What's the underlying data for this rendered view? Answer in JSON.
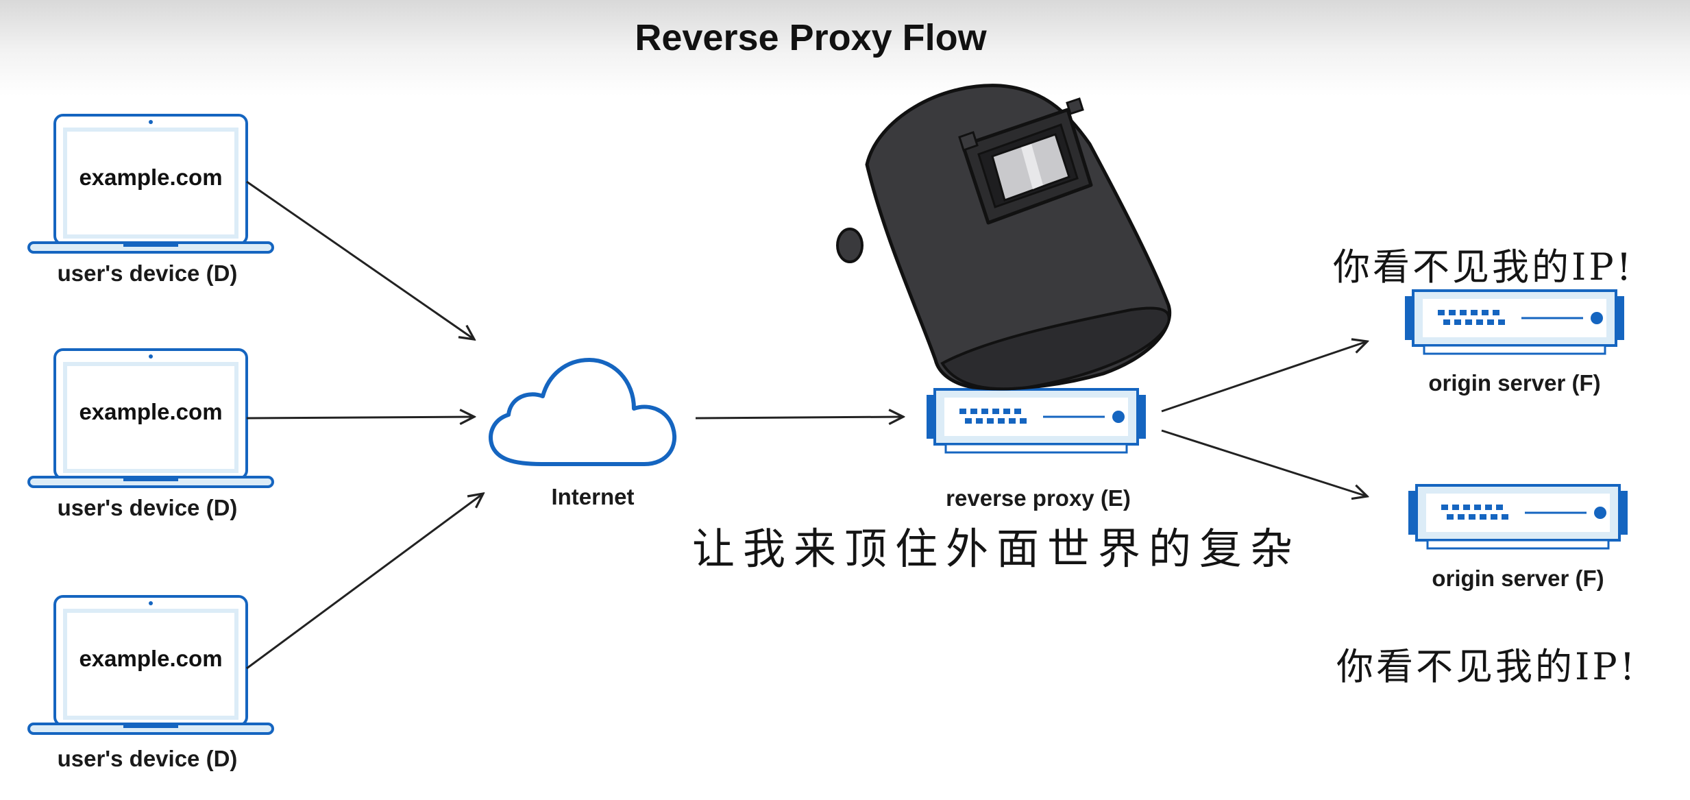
{
  "title": "Reverse Proxy Flow",
  "devices": [
    {
      "screen_text": "example.com",
      "label": "user's device (D)"
    },
    {
      "screen_text": "example.com",
      "label": "user's device (D)"
    },
    {
      "screen_text": "example.com",
      "label": "user's device (D)"
    }
  ],
  "internet": {
    "label": "Internet"
  },
  "proxy": {
    "label": "reverse proxy (E)",
    "overlay_icon": "welding-helmet-icon"
  },
  "servers": [
    {
      "label": "origin server (F)",
      "caption": "你看不见我的IP!"
    },
    {
      "label": "origin server (F)",
      "caption": "你看不见我的IP!"
    }
  ],
  "proxy_caption": "让我来顶住外面世界的复杂",
  "colors": {
    "accent": "#1565c0",
    "light_fill": "#dcecf7",
    "helmet": "#3a3a3d"
  }
}
